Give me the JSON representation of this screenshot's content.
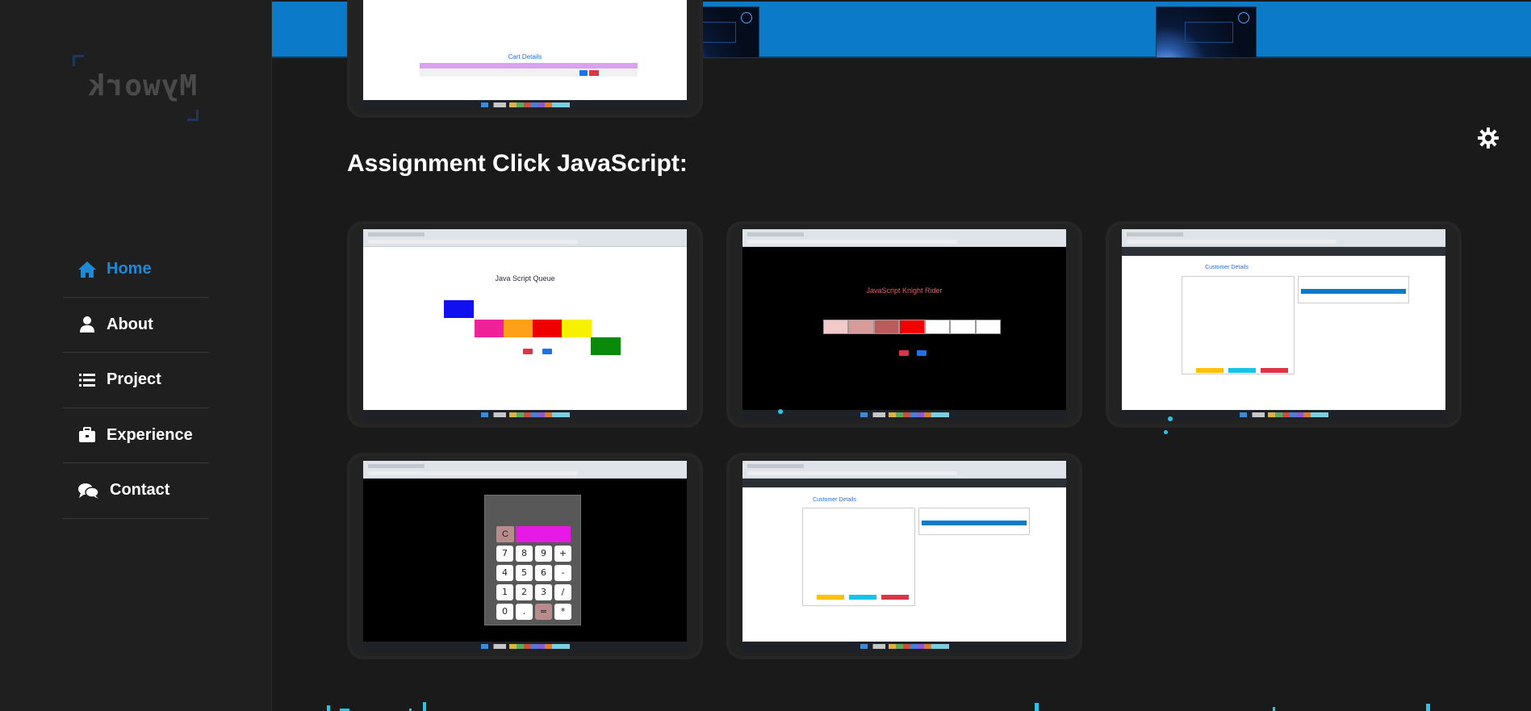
{
  "sidebar": {
    "logo_text": "Mywork",
    "items": [
      {
        "label": "Home",
        "icon": "home-icon",
        "active": true
      },
      {
        "label": "About",
        "icon": "user-icon",
        "active": false
      },
      {
        "label": "Project",
        "icon": "list-icon",
        "active": false
      },
      {
        "label": "Experience",
        "icon": "briefcase-icon",
        "active": false
      },
      {
        "label": "Contact",
        "icon": "comments-icon",
        "active": false
      }
    ]
  },
  "header": {
    "accent": "#0b7ac9"
  },
  "main": {
    "section_title": "Assignment Click JavaScript:",
    "top_card_label": "Cart Details",
    "cards": [
      {
        "name": "javascript-queue-card",
        "title": "Java Script Queue"
      },
      {
        "name": "knight-rider-card",
        "title": "JavaScript Knight Rider"
      },
      {
        "name": "customer-details-card-1",
        "title": "Customer Details"
      },
      {
        "name": "calculator-card",
        "title": "Calculator"
      },
      {
        "name": "customer-details-card-2",
        "title": "Customer Details"
      }
    ]
  },
  "colors": {
    "background": "#1a1a1a",
    "active_nav": "#1e8ad6",
    "accent_dot": "#29c5e6"
  }
}
